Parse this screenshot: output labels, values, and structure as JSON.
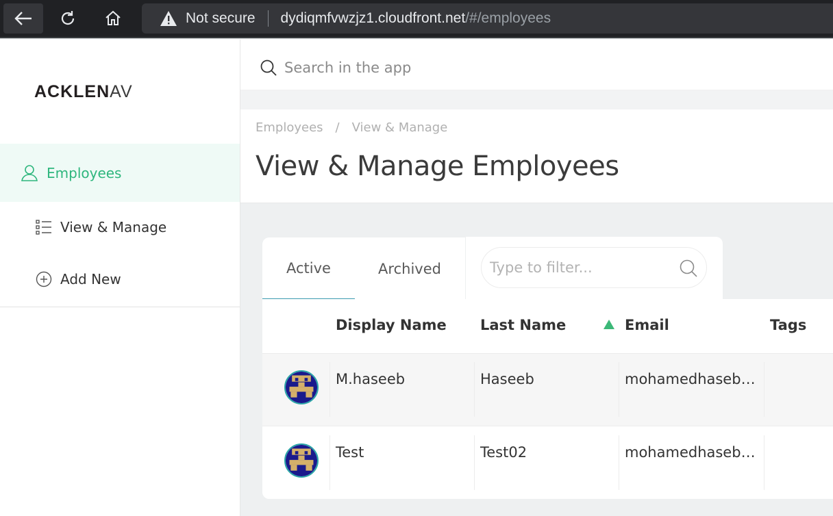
{
  "browser": {
    "security_label": "Not secure",
    "url_host": "dydiqmfvwzjz1.cloudfront.net",
    "url_path": "/#/employees"
  },
  "sidebar": {
    "logo_bold": "ACKLEN",
    "logo_light": "AV",
    "primary_item": {
      "label": "Employees",
      "icon": "person-icon"
    },
    "items": [
      {
        "label": "View & Manage",
        "icon": "list-icon"
      },
      {
        "label": "Add New",
        "icon": "plus-circle-icon"
      }
    ]
  },
  "topbar": {
    "search_placeholder": "Search in the app"
  },
  "page": {
    "breadcrumb": [
      "Employees",
      "View & Manage"
    ],
    "breadcrumb_separator": "/",
    "title": "View & Manage Employees"
  },
  "tabs": [
    {
      "label": "Active",
      "selected": true
    },
    {
      "label": "Archived",
      "selected": false
    }
  ],
  "filter": {
    "placeholder": "Type to filter..."
  },
  "table": {
    "columns": [
      "Display Name",
      "Last Name",
      "Email",
      "Tags"
    ],
    "sort_column": "Email",
    "sort_direction": "ascending",
    "rows": [
      {
        "display_name": "M.haseeb",
        "last_name": "Haseeb",
        "email": "mohamedhaseb9...",
        "tags": ""
      },
      {
        "display_name": "Test",
        "last_name": "Test02",
        "email": "mohamedhaseb9...",
        "tags": ""
      }
    ]
  },
  "colors": {
    "accent_green": "#2eb67d",
    "active_tab_underline": "#3a9bb0",
    "sort_indicator": "#3cb878"
  }
}
